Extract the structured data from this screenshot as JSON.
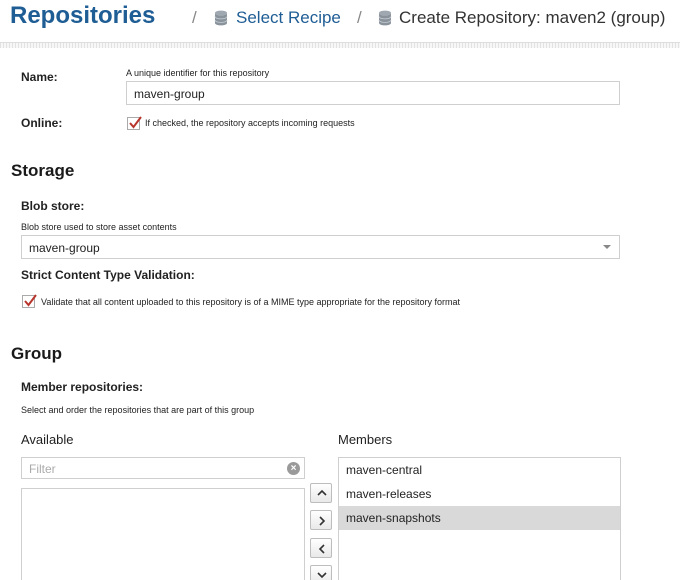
{
  "breadcrumb": {
    "title": "Repositories",
    "separator": "/",
    "recipe_link": "Select Recipe",
    "current": "Create Repository: maven2 (group)"
  },
  "name_field": {
    "label": "Name:",
    "help": "A unique identifier for this repository",
    "value": "maven-group"
  },
  "online_field": {
    "label": "Online:",
    "checked": true,
    "checkbox_label": "If checked, the repository accepts incoming requests"
  },
  "storage": {
    "heading": "Storage",
    "blob_store": {
      "label": "Blob store:",
      "help": "Blob store used to store asset contents",
      "value": "maven-group"
    },
    "strict_validation": {
      "label": "Strict Content Type Validation:",
      "checked": true,
      "checkbox_label": "Validate that all content uploaded to this repository is of a MIME type appropriate for the repository format"
    }
  },
  "group": {
    "heading": "Group",
    "members_label": "Member repositories:",
    "help": "Select and order the repositories that are part of this group",
    "available_heading": "Available",
    "filter_placeholder": "Filter",
    "members_heading": "Members",
    "members": [
      "maven-central",
      "maven-releases",
      "maven-snapshots"
    ],
    "selected_member": "maven-snapshots"
  },
  "colors": {
    "accent": "#1f5d95",
    "selected_row": "#d9d9d9",
    "check_mark": "#b8352d"
  },
  "icons": [
    "database-icon",
    "chevron-up-icon",
    "chevron-right-icon",
    "chevron-left-icon",
    "chevron-down-icon",
    "clear-icon",
    "dropdown-arrow-icon",
    "checkmark-icon"
  ]
}
